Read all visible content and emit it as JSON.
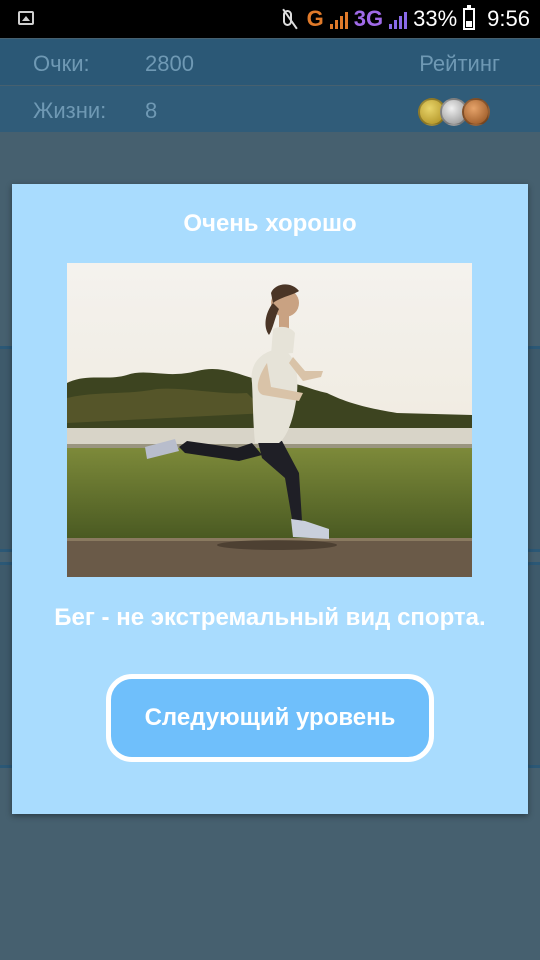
{
  "status_bar": {
    "network_g": "G",
    "network_3g": "3G",
    "battery": "33%",
    "time": "9:56"
  },
  "header": {
    "points_label": "Очки:",
    "points_value": "2800",
    "rating_label": "Рейтинг",
    "lives_label": "Жизни:",
    "lives_value": "8",
    "medal_icons": [
      "gold-medal-icon",
      "silver-medal-icon",
      "bronze-medal-icon"
    ]
  },
  "dialog": {
    "title": "Очень хорошо",
    "fact": "Бег - не экстремальный вид спорта.",
    "next_button": "Следующий уровень"
  },
  "colors": {
    "header_bg": "#2b5876",
    "dialog_bg": "#a9dcfe",
    "button_bg": "#6fbffb",
    "overlay_bg": "#46606f"
  }
}
